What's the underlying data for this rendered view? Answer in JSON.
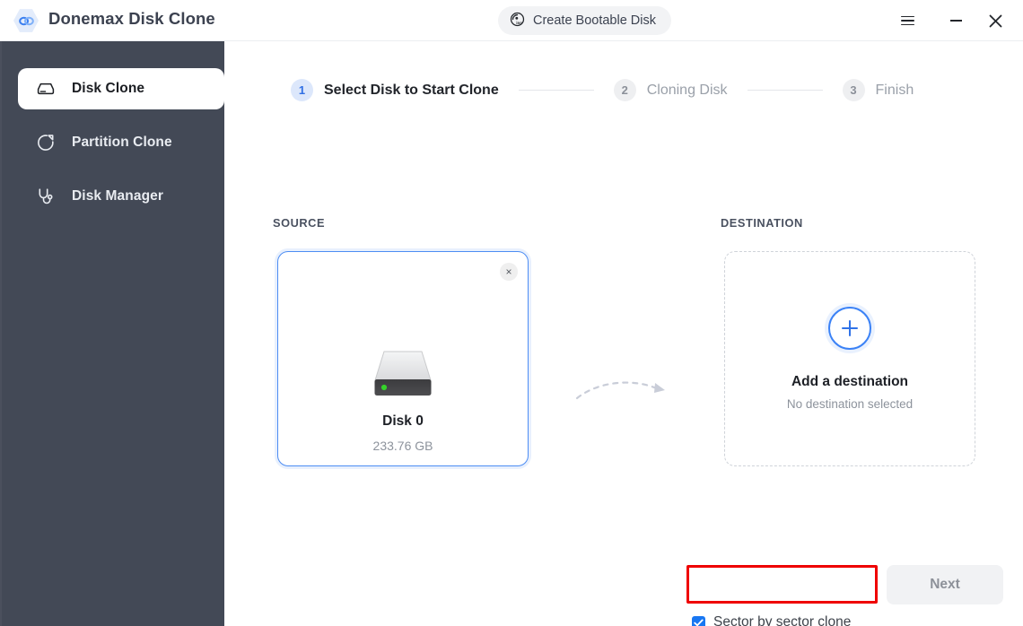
{
  "window": {
    "app_title": "Donemax Disk Clone",
    "logo_icon": "chain-link-logo",
    "bootable_button": {
      "label": "Create Bootable Disk",
      "icon": "iso-disc-icon"
    },
    "controls": {
      "menu": "hamburger-menu-icon",
      "minimize": "minimize-icon",
      "close": "close-icon"
    }
  },
  "sidebar": {
    "items": [
      {
        "label": "Disk Clone",
        "icon": "hard-drive-icon",
        "active": true
      },
      {
        "label": "Partition Clone",
        "icon": "pie-chart-icon",
        "active": false
      },
      {
        "label": "Disk Manager",
        "icon": "stethoscope-icon",
        "active": false
      }
    ]
  },
  "steps": [
    {
      "num": "1",
      "label": "Select Disk to Start Clone",
      "state": "active"
    },
    {
      "num": "2",
      "label": "Cloning Disk",
      "state": "idle"
    },
    {
      "num": "3",
      "label": "Finish",
      "state": "idle"
    }
  ],
  "panels": {
    "source": {
      "heading": "SOURCE",
      "disk_name": "Disk 0",
      "disk_size": "233.76 GB",
      "close_glyph": "×",
      "icon": "external-hard-drive-icon"
    },
    "destination": {
      "heading": "DESTINATION",
      "title": "Add a destination",
      "subtitle": "No destination selected",
      "icon": "plus-circle-icon"
    },
    "flow_arrow_icon": "dashed-curved-arrow-icon"
  },
  "footer": {
    "checkbox_label": "Sector by sector clone",
    "checkbox_checked": true,
    "next_label": "Next",
    "next_disabled": true
  },
  "colors": {
    "sidebar_bg": "#434956",
    "accent_blue": "#3b82f6",
    "checkbox_blue": "#1877f2",
    "annotation_red": "#ef0000",
    "disabled_gray": "#8d9199",
    "step_active_bg": "#dce7fb"
  }
}
